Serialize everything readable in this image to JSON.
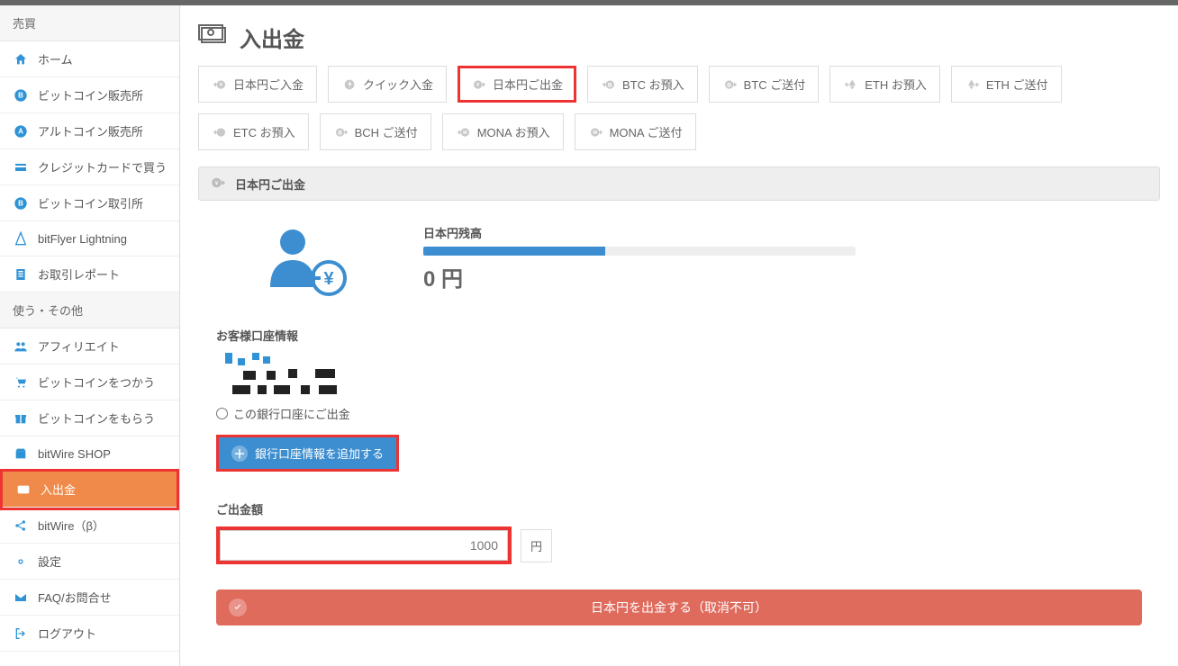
{
  "page": {
    "title": "入出金"
  },
  "sidebar": {
    "section1_header": "売買",
    "section2_header": "使う・その他",
    "items1": [
      {
        "label": "ホーム"
      },
      {
        "label": "ビットコイン販売所"
      },
      {
        "label": "アルトコイン販売所"
      },
      {
        "label": "クレジットカードで買う"
      },
      {
        "label": "ビットコイン取引所"
      },
      {
        "label": "bitFlyer Lightning"
      },
      {
        "label": "お取引レポート"
      }
    ],
    "items2": [
      {
        "label": "アフィリエイト"
      },
      {
        "label": "ビットコインをつかう"
      },
      {
        "label": "ビットコインをもらう"
      },
      {
        "label": "bitWire SHOP"
      },
      {
        "label": "入出金"
      },
      {
        "label": "bitWire（β）"
      },
      {
        "label": "設定"
      },
      {
        "label": "FAQ/お問合せ"
      },
      {
        "label": "ログアウト"
      }
    ]
  },
  "tabs": [
    {
      "label": "日本円ご入金"
    },
    {
      "label": "クイック入金"
    },
    {
      "label": "日本円ご出金"
    },
    {
      "label": "BTC お預入"
    },
    {
      "label": "BTC ご送付"
    },
    {
      "label": "ETH お預入"
    },
    {
      "label": "ETH ご送付"
    },
    {
      "label": "ETC お預入"
    },
    {
      "label": "BCH ご送付"
    },
    {
      "label": "MONA お預入"
    },
    {
      "label": "MONA ご送付"
    }
  ],
  "section": {
    "title": "日本円ご出金"
  },
  "balance": {
    "label": "日本円残高",
    "amount": "0 円"
  },
  "account": {
    "header": "お客様口座情報",
    "radio_label": "この銀行口座にご出金",
    "add_button": "銀行口座情報を追加する"
  },
  "withdraw": {
    "amount_label": "ご出金額",
    "placeholder": "1000",
    "unit": "円",
    "button": "日本円を出金する（取消不可）"
  }
}
